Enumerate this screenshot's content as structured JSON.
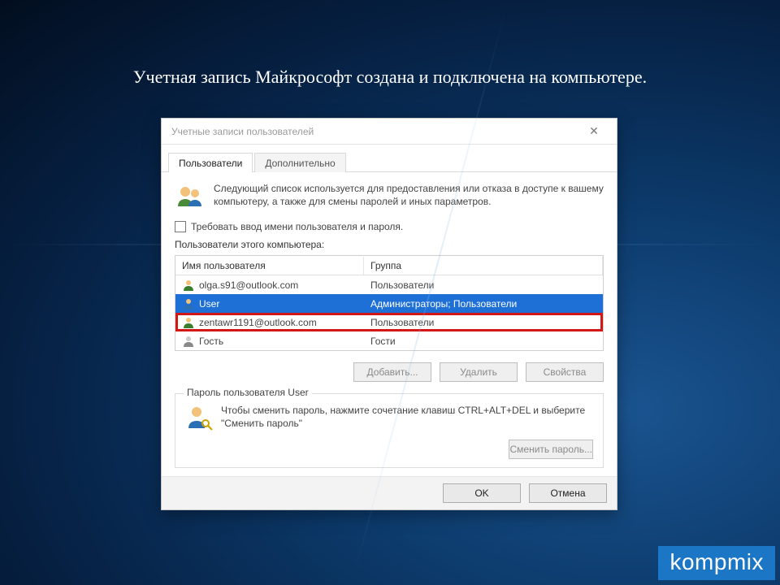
{
  "caption": "Учетная запись Майкрософт создана и подключена на компьютере.",
  "dialog": {
    "title": "Учетные записи пользователей",
    "close_glyph": "✕",
    "tabs": {
      "users": "Пользователи",
      "advanced": "Дополнительно"
    },
    "intro": "Следующий список используется для предоставления или отказа в доступе к вашему компьютеру, а также для смены паролей и иных параметров.",
    "require_login_label": "Требовать ввод имени пользователя и пароля.",
    "list_label": "Пользователи этого компьютера:",
    "columns": {
      "name": "Имя пользователя",
      "group": "Группа"
    },
    "rows": [
      {
        "name": "olga.s91@outlook.com",
        "group": "Пользователи",
        "selected": false,
        "highlight": false
      },
      {
        "name": "User",
        "group": "Администраторы; Пользователи",
        "selected": true,
        "highlight": false
      },
      {
        "name": "zentawr1191@outlook.com",
        "group": "Пользователи",
        "selected": false,
        "highlight": true
      },
      {
        "name": "Гость",
        "group": "Гости",
        "selected": false,
        "highlight": false
      }
    ],
    "buttons": {
      "add": "Добавить...",
      "remove": "Удалить",
      "props": "Свойства"
    },
    "password_group": {
      "legend": "Пароль пользователя User",
      "text": "Чтобы сменить пароль, нажмите сочетание клавиш CTRL+ALT+DEL и выберите \"Сменить пароль\"",
      "change_btn": "Сменить пароль..."
    },
    "footer": {
      "ok": "OK",
      "cancel": "Отмена"
    }
  },
  "watermark": "kompmix"
}
